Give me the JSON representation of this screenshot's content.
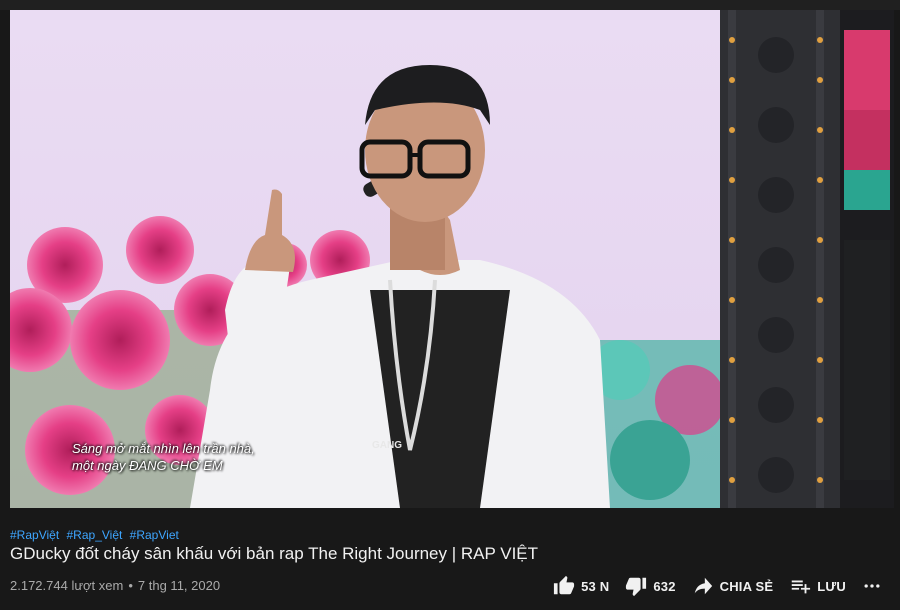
{
  "video": {
    "subtitle_line1": "Sáng mở mắt nhìn lên trần nhà,",
    "subtitle_line2": "một ngày ĐANG CHỜ EM",
    "shirt_text": "GANG"
  },
  "hashtags": [
    "#RapViệt",
    "#Rap_Việt",
    "#RapViet"
  ],
  "title": "GDucky đốt cháy sân khấu với bản rap The Right Journey | RAP VIỆT",
  "meta": {
    "views": "2.172.744 lượt xem",
    "separator": "•",
    "date": "7 thg 11, 2020"
  },
  "actions": {
    "like_count": "53 N",
    "dislike_count": "632",
    "share_label": "CHIA SẺ",
    "save_label": "LƯU"
  },
  "icons": {
    "like": "thumb-up-icon",
    "dislike": "thumb-down-icon",
    "share": "share-arrow-icon",
    "save": "playlist-add-icon",
    "more": "more-horizontal-icon"
  },
  "colors": {
    "background": "#181818",
    "link": "#3ea6ff",
    "meta_text": "#aaaaaa"
  }
}
